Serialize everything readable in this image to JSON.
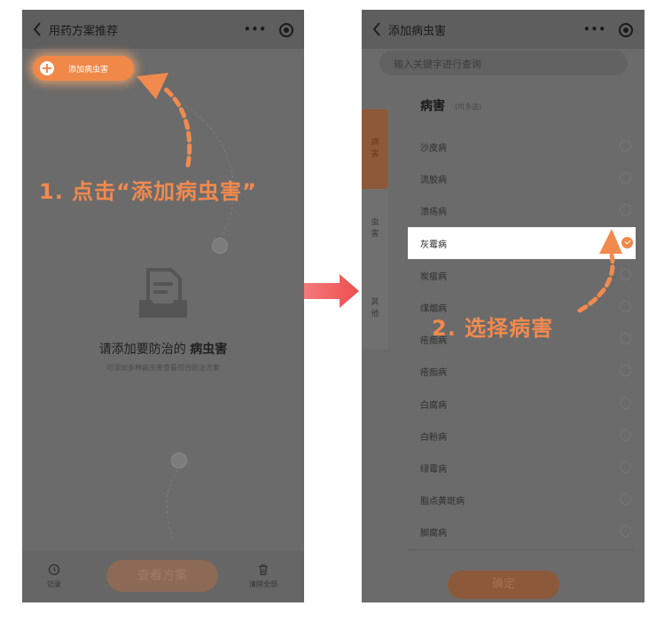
{
  "left_screen": {
    "nav_title": "用药方案推荐",
    "add_button_label": "添加病虫害",
    "empty_text_prefix": "请添加要防治的 ",
    "empty_text_bold": "病虫害",
    "empty_subtext": "可添加多种病虫害查看综合防治方案",
    "bottom": {
      "history_label": "记录",
      "plan_button_label": "查看方案",
      "clear_label": "清除全部"
    }
  },
  "right_screen": {
    "nav_title": "添加病虫害",
    "search_placeholder": "输入关键字进行查询",
    "side_tabs": [
      "病害",
      "虫害",
      "其他"
    ],
    "section_title": "病害",
    "section_subtitle": "(可多选)",
    "diseases": [
      {
        "name": "沙皮病",
        "selected": false
      },
      {
        "name": "流胶病",
        "selected": false
      },
      {
        "name": "溃疡病",
        "selected": false
      },
      {
        "name": "灰霉病",
        "selected": true
      },
      {
        "name": "炭疽病",
        "selected": false
      },
      {
        "name": "煤烟病",
        "selected": false
      },
      {
        "name": "疮痂病",
        "selected": false
      },
      {
        "name": "疮痂病",
        "selected": false
      },
      {
        "name": "白腐病",
        "selected": false
      },
      {
        "name": "白粉病",
        "selected": false
      },
      {
        "name": "绿霉病",
        "selected": false
      },
      {
        "name": "脂点黄斑病",
        "selected": false
      },
      {
        "name": "脚腐病",
        "selected": false
      }
    ],
    "confirm_label": "确定"
  },
  "annotations": {
    "step1": "1. 点击“添加病虫害”",
    "step2": "2. 选择病害"
  },
  "colors": {
    "accent": "#f08848",
    "annotation": "#f28a4e",
    "arrow": "#f15a5a"
  }
}
